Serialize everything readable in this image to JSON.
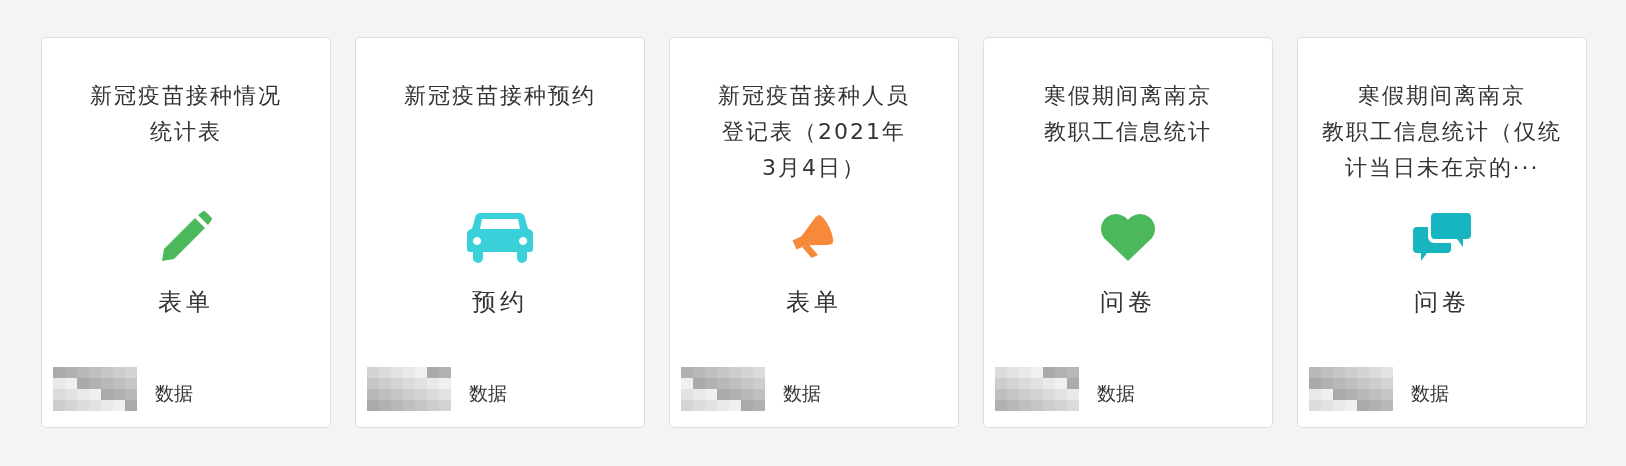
{
  "cards": [
    {
      "title_lines": [
        "新冠疫苗接种情况",
        "统计表"
      ],
      "kind": "pencil",
      "color": "#4cb85c",
      "type": "表单",
      "data_label": "数据"
    },
    {
      "title_lines": [
        "新冠疫苗接种预约"
      ],
      "kind": "car",
      "color": "#3ad0da",
      "type": "预约",
      "data_label": "数据"
    },
    {
      "title_lines": [
        "新冠疫苗接种人员",
        "登记表（2021年",
        "3月4日）"
      ],
      "kind": "megaphone",
      "color": "#f7893b",
      "type": "表单",
      "data_label": "数据"
    },
    {
      "title_lines": [
        "寒假期间离南京",
        "教职工信息统计"
      ],
      "kind": "heart",
      "color": "#4cb85c",
      "type": "问卷",
      "data_label": "数据"
    },
    {
      "title_lines": [
        "寒假期间离南京",
        "教职工信息统计（仅统",
        "计当日未在京的···"
      ],
      "kind": "chat",
      "color": "#17b5bf",
      "type": "问卷",
      "data_label": "数据"
    }
  ]
}
